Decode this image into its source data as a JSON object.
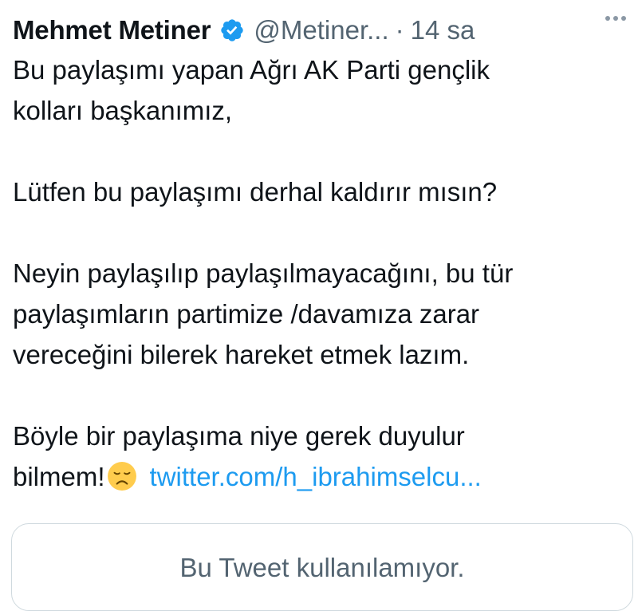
{
  "tweet": {
    "author_name": "Mehmet Metiner",
    "handle": "@Metiner...",
    "separator": "·",
    "time": "14 sa",
    "verified": true,
    "lines": {
      "l1": "Bu paylaşımı yapan Ağrı AK Parti gençlik",
      "l2": "kolları başkanımız,",
      "l3": "Lütfen bu paylaşımı derhal kaldırır mısın?",
      "l4": "Neyin paylaşılıp paylaşılmayacağını, bu tür",
      "l5": "paylaşımların partimize /davamıza zarar",
      "l6": "vereceğini bilerek hareket etmek lazım.",
      "l7": "Böyle bir paylaşıma niye gerek duyulur",
      "l8": "bilmem!"
    },
    "link_text": "twitter.com/h_ibrahimselcu...",
    "emoji": "disappointed-face",
    "quoted_unavailable": "Bu Tweet kullanılamıyor."
  },
  "colors": {
    "text": "#0f1419",
    "secondary": "#536471",
    "link": "#1d9bf0",
    "verified": "#1d9bf0",
    "border": "#cfd9de"
  }
}
